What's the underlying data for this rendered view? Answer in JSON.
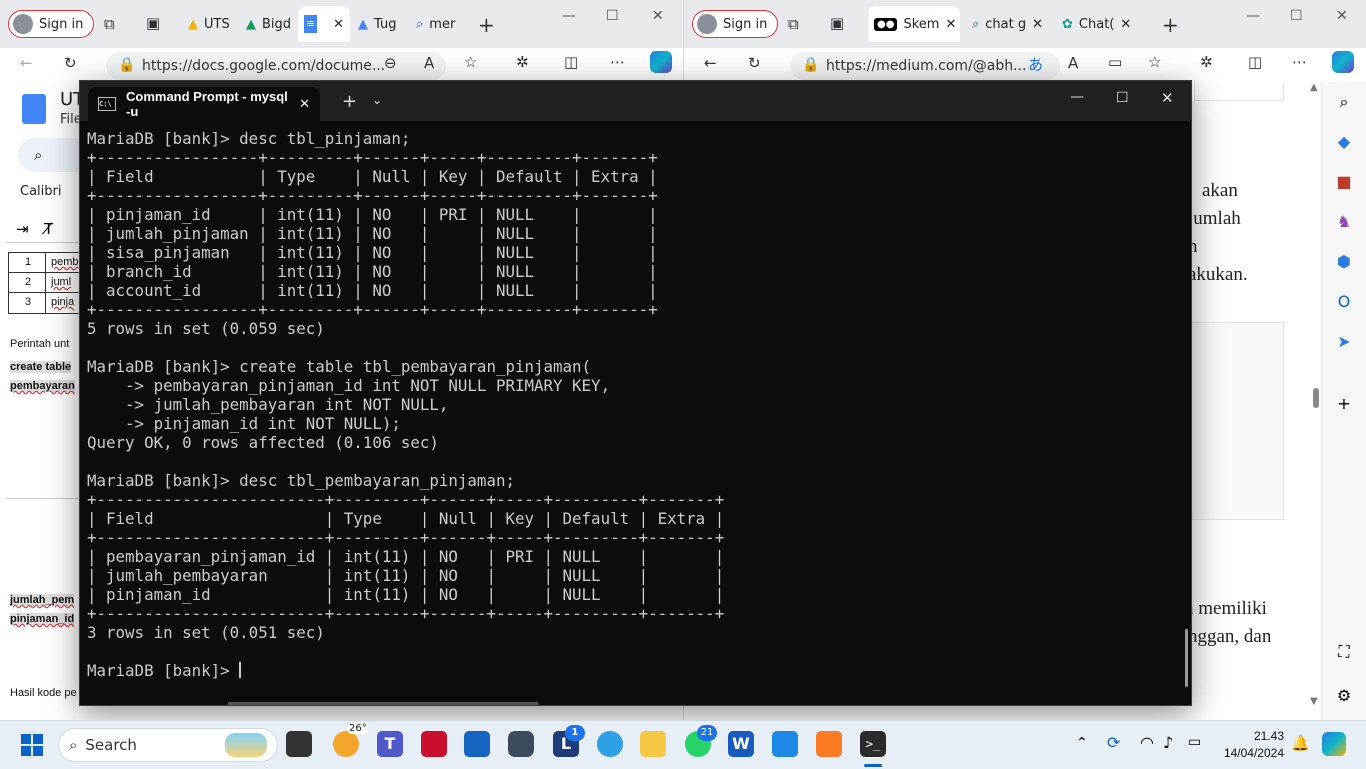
{
  "left_browser": {
    "signin_label": "Sign in",
    "tabs": [
      "UTS",
      "Bigd",
      "Tug",
      "mer"
    ],
    "url": "https://docs.google.com/docume...",
    "doc_title": "UT",
    "doc_menu": "File",
    "font_name": "Calibri",
    "table_rows": [
      {
        "num": "1",
        "text": "pemb"
      },
      {
        "num": "2",
        "text": "juml"
      },
      {
        "num": "3",
        "text": "pinja"
      }
    ],
    "body_text_1": "Perintah unt",
    "body_bold_1": "create table",
    "body_bold_2": "pembayaran",
    "body_bold_3": "jumlah_pem",
    "body_bold_4": "pinjaman_id",
    "body_text_2": "Hasil kode pe"
  },
  "right_browser": {
    "signin_label": "Sign in",
    "tabs": [
      "Skem",
      "chat g",
      "Chat("
    ],
    "url": "https://medium.com/@abh...",
    "article_lines": [
      "akan",
      "jumlah",
      "n",
      "akukan.",
      "n memiliki",
      "nggan, dan"
    ]
  },
  "terminal": {
    "tab_title": "Command Prompt - mysql  -u",
    "lines": [
      "MariaDB [bank]> desc tbl_pinjaman;",
      "+-----------------+---------+------+-----+---------+-------+",
      "| Field           | Type    | Null | Key | Default | Extra |",
      "+-----------------+---------+------+-----+---------+-------+",
      "| pinjaman_id     | int(11) | NO   | PRI | NULL    |       |",
      "| jumlah_pinjaman | int(11) | NO   |     | NULL    |       |",
      "| sisa_pinjaman   | int(11) | NO   |     | NULL    |       |",
      "| branch_id       | int(11) | NO   |     | NULL    |       |",
      "| account_id      | int(11) | NO   |     | NULL    |       |",
      "+-----------------+---------+------+-----+---------+-------+",
      "5 rows in set (0.059 sec)",
      "",
      "MariaDB [bank]> create table tbl_pembayaran_pinjaman(",
      "    -> pembayaran_pinjaman_id int NOT NULL PRIMARY KEY,",
      "    -> jumlah_pembayaran int NOT NULL,",
      "    -> pinjaman_id int NOT NULL);",
      "Query OK, 0 rows affected (0.106 sec)",
      "",
      "MariaDB [bank]> desc tbl_pembayaran_pinjaman;",
      "+------------------------+---------+------+-----+---------+-------+",
      "| Field                  | Type    | Null | Key | Default | Extra |",
      "+------------------------+---------+------+-----+---------+-------+",
      "| pembayaran_pinjaman_id | int(11) | NO   | PRI | NULL    |       |",
      "| jumlah_pembayaran      | int(11) | NO   |     | NULL    |       |",
      "| pinjaman_id            | int(11) | NO   |     | NULL    |       |",
      "+------------------------+---------+------+-----+---------+-------+",
      "3 rows in set (0.051 sec)",
      ""
    ],
    "prompt": "MariaDB [bank]> "
  },
  "taskbar": {
    "search_label": "Search",
    "weather_temp": "26°",
    "badge_l": "1",
    "badge_whatsapp": "21",
    "time": "21.43",
    "date": "14/04/2024"
  },
  "colors": {
    "terminal_bg": "#0c0c0c",
    "terminal_text": "#cccccc",
    "signin_border": "#dd3333",
    "accent_blue": "#1a73e8"
  }
}
